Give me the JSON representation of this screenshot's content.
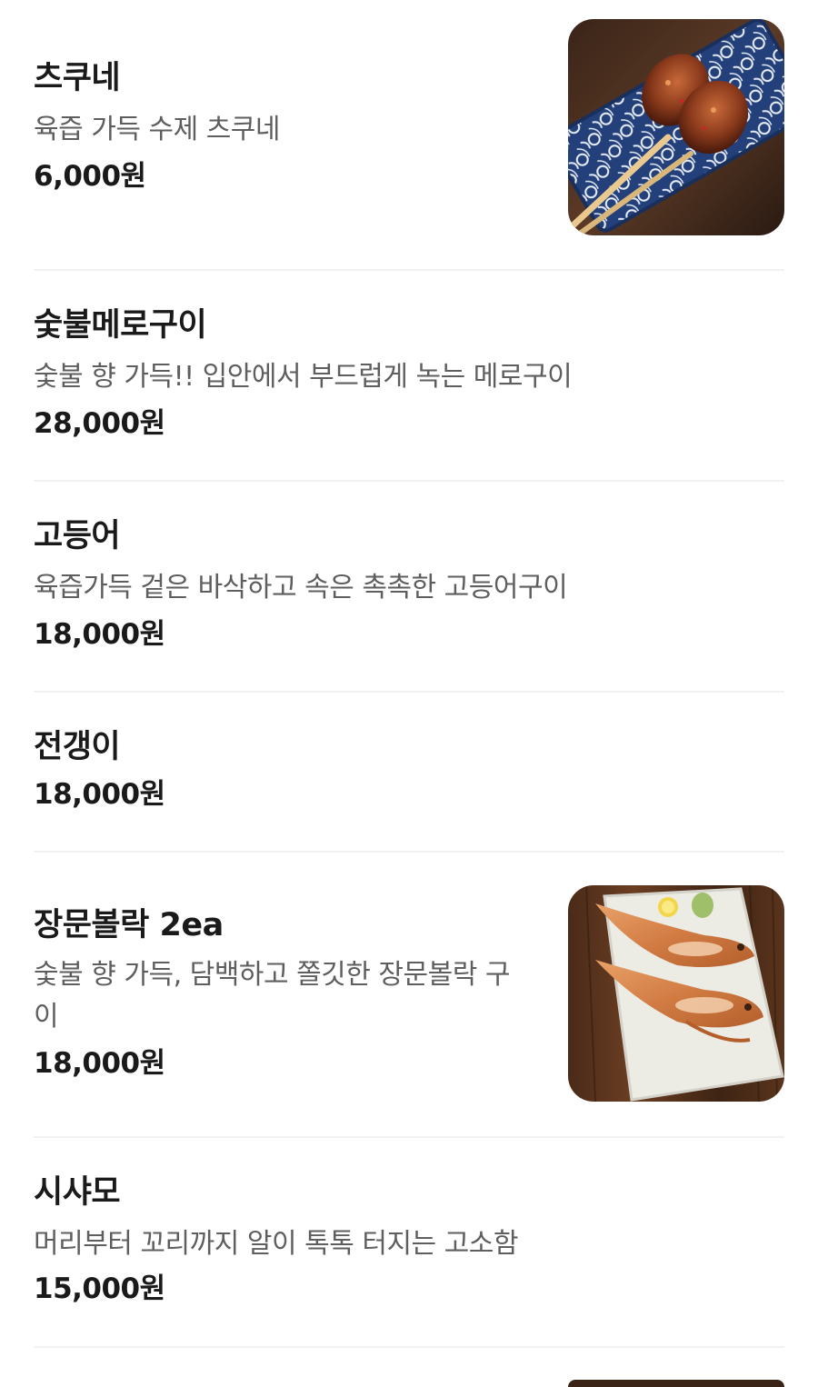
{
  "menu": {
    "items": [
      {
        "name": "츠쿠네",
        "description": "육즙 가득 수제 츠쿠네",
        "price": "6,000원",
        "image_icon": "tsukune-skewer-photo"
      },
      {
        "name": "숯불메로구이",
        "description": "숯불 향 가득!! 입안에서 부드럽게 녹는 메로구이",
        "price": "28,000원"
      },
      {
        "name": "고등어",
        "description": "육즙가득 겉은 바삭하고 속은 촉촉한 고등어구이",
        "price": "18,000원"
      },
      {
        "name": "전갱이",
        "price": "18,000원"
      },
      {
        "name": "장문볼락 2ea",
        "description": "숯불 향 가득, 담백하고 쫄깃한 장문볼락 구이",
        "price": "18,000원",
        "image_icon": "grilled-rockfish-photo"
      },
      {
        "name": "시샤모",
        "description": "머리부터 꼬리까지 알이 톡톡 터지는 고소함",
        "price": "15,000원"
      }
    ]
  },
  "colors": {
    "text_primary": "#1a1a1a",
    "text_secondary": "#5e5e5e",
    "divider": "#f1f1f1",
    "background": "#ffffff"
  }
}
